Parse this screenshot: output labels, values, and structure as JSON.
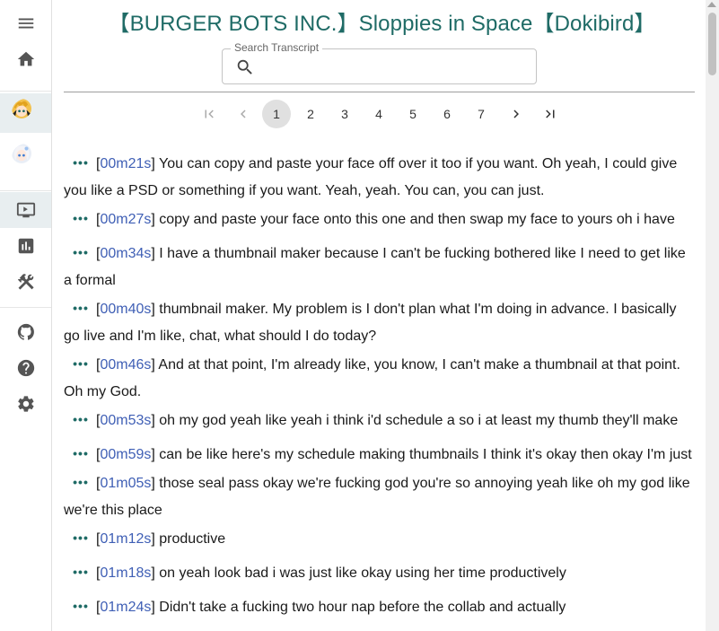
{
  "title": "【BURGER BOTS INC.】Sloppies in Space【Dokibird】",
  "search": {
    "label": "Search Transcript",
    "value": "",
    "placeholder": ""
  },
  "sidebar": {
    "menu_icon": "menu-icon",
    "home_icon": "home-icon",
    "avatars": [
      "avatar-channel-1",
      "avatar-channel-2"
    ],
    "tools": [
      "tv-icon",
      "bar-chart-icon",
      "tools-icon"
    ],
    "links": [
      "github-icon",
      "help-icon",
      "settings-icon"
    ]
  },
  "pagination": {
    "current": 1,
    "pages": [
      "1",
      "2",
      "3",
      "4",
      "5",
      "6",
      "7"
    ]
  },
  "transcript": [
    {
      "ts": "00m21s",
      "text": "You can copy and paste your face off over it too if you want. Oh yeah, I could give you like a PSD or something if you want. Yeah, yeah. You can, you can just."
    },
    {
      "ts": "00m27s",
      "text": "copy and paste your face onto this one and then swap my face to yours oh i have"
    },
    {
      "ts": "00m34s",
      "text": "I have a thumbnail maker because I can't be fucking bothered like I need to get like a formal"
    },
    {
      "ts": "00m40s",
      "text": "thumbnail maker. My problem is I don't plan what I'm doing in advance. I basically go live and I'm like, chat, what should I do today?"
    },
    {
      "ts": "00m46s",
      "text": "And at that point, I'm already like, you know, I can't make a thumbnail at that point. Oh my God."
    },
    {
      "ts": "00m53s",
      "text": "oh my god yeah like yeah i think i'd schedule a so i at least my thumb they'll make"
    },
    {
      "ts": "00m59s",
      "text": "can be like here's my schedule making thumbnails I think it's okay then okay I'm just"
    },
    {
      "ts": "01m05s",
      "text": "those seal pass okay we're fucking god you're so annoying yeah like oh my god like we're this place"
    },
    {
      "ts": "01m12s",
      "text": "productive"
    },
    {
      "ts": "01m18s",
      "text": "on yeah look bad i was just like okay using her time productively"
    },
    {
      "ts": "01m24s",
      "text": "Didn't take a fucking two hour nap before the collab and actually"
    }
  ],
  "colors": {
    "accent": "#1f6b66",
    "link": "#3f5fb5"
  }
}
